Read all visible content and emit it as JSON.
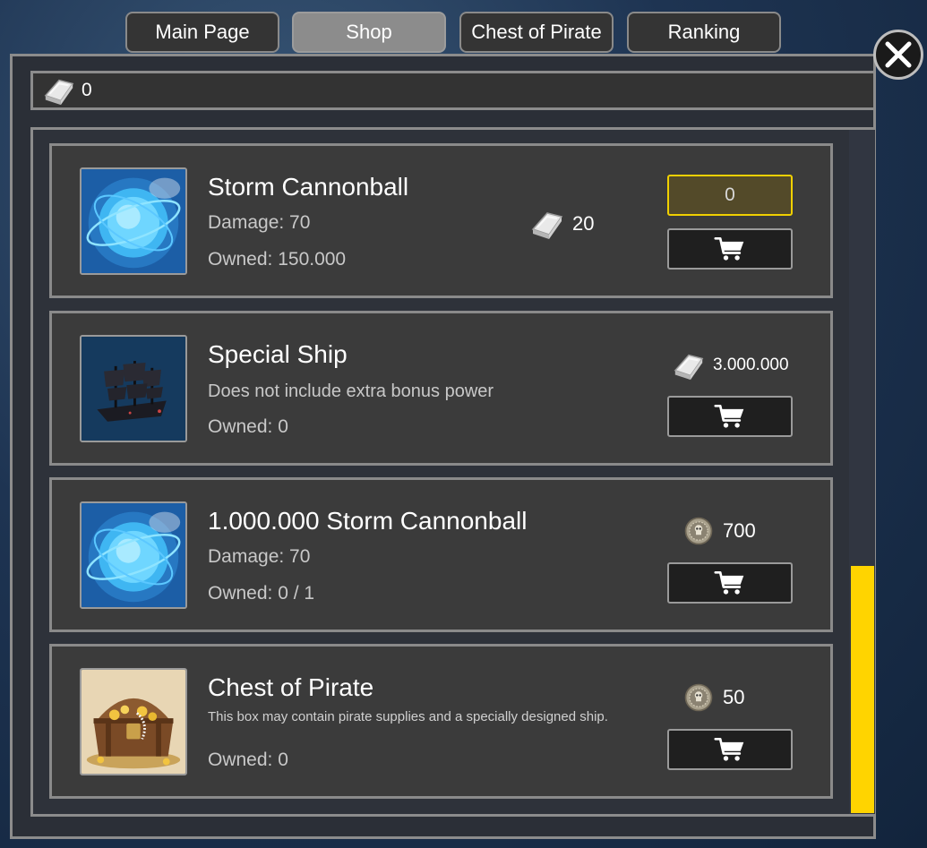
{
  "tabs": [
    {
      "label": "Main Page",
      "active": false
    },
    {
      "label": "Shop",
      "active": true
    },
    {
      "label": "Chest of Pirate",
      "active": false
    },
    {
      "label": "Ranking",
      "active": false
    }
  ],
  "currency": {
    "icon": "silver-bar-icon",
    "amount": "0"
  },
  "scroll": {
    "position_fraction": 1.0
  },
  "items": [
    {
      "title": "Storm Cannonball",
      "line1": "Damage: 70",
      "owned": "Owned: 150.000",
      "price": "20",
      "price_icon": "silver-bar-icon",
      "quantity": "0",
      "image": "storm-cannonball"
    },
    {
      "title": "Special Ship",
      "line1": "Does not include extra bonus power",
      "owned": "Owned: 0",
      "price": "3.000.000",
      "price_icon": "silver-bar-icon",
      "image": "special-ship"
    },
    {
      "title": "1.000.000 Storm Cannonball",
      "line1": "Damage: 70",
      "owned": "Owned: 0 / 1",
      "price": "700",
      "price_icon": "pirate-coin-icon",
      "image": "storm-cannonball"
    },
    {
      "title": "Chest of Pirate",
      "line1": "This box may contain pirate supplies and a specially designed ship.",
      "owned": "Owned: 0",
      "price": "50",
      "price_icon": "pirate-coin-icon",
      "image": "treasure-chest"
    }
  ],
  "colors": {
    "scrollbar_thumb": "#ffd400",
    "quantity_border": "#f0d000",
    "panel_border": "#8c8c8c",
    "item_background": "#3b3b3b"
  }
}
